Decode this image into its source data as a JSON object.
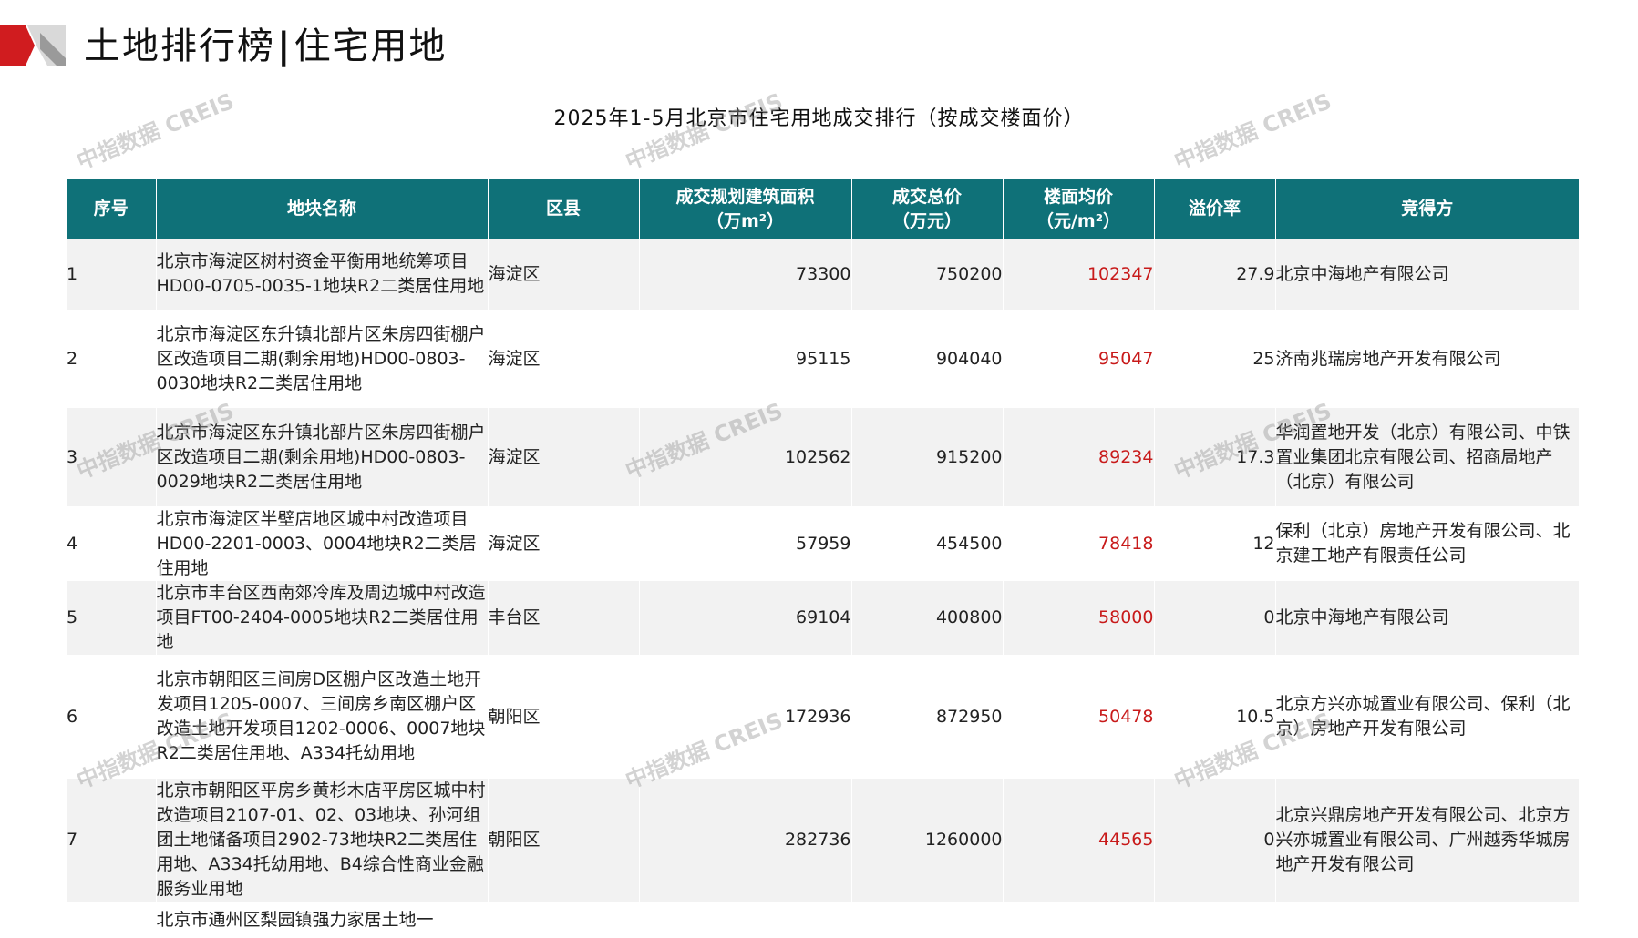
{
  "header": {
    "title_left": "土地排行榜",
    "separator": "|",
    "title_right": "住宅用地"
  },
  "watermark": {
    "text": "中指数据 CREIS"
  },
  "table_title": "2025年1-5月北京市住宅用地成交排行（按成交楼面价）",
  "columns": {
    "num": "序号",
    "name": "地块名称",
    "district": "区县",
    "area": "成交规划建筑面积\n（万m²）",
    "total": "成交总价\n（万元）",
    "price": "楼面均价\n（元/m²）",
    "premium": "溢价率",
    "bidder": "竞得方"
  },
  "rows": [
    {
      "num": "1",
      "name": "北京市海淀区树村资金平衡用地统筹项目HD00-0705-0035-1地块R2二类居住用地",
      "district": "海淀区",
      "area": "73300",
      "total": "750200",
      "price": "102347",
      "premium": "27.9",
      "bidder": "北京中海地产有限公司"
    },
    {
      "num": "2",
      "name": "北京市海淀区东升镇北部片区朱房四街棚户区改造项目二期(剩余用地)HD00-0803-0030地块R2二类居住用地",
      "district": "海淀区",
      "area": "95115",
      "total": "904040",
      "price": "95047",
      "premium": "25",
      "bidder": "济南兆瑞房地产开发有限公司"
    },
    {
      "num": "3",
      "name": "北京市海淀区东升镇北部片区朱房四街棚户区改造项目二期(剩余用地)HD00-0803-0029地块R2二类居住用地",
      "district": "海淀区",
      "area": "102562",
      "total": "915200",
      "price": "89234",
      "premium": "17.3",
      "bidder": "华润置地开发（北京）有限公司、中铁置业集团北京有限公司、招商局地产（北京）有限公司"
    },
    {
      "num": "4",
      "name": "北京市海淀区半壁店地区城中村改造项目HD00-2201-0003、0004地块R2二类居住用地",
      "district": "海淀区",
      "area": "57959",
      "total": "454500",
      "price": "78418",
      "premium": "12",
      "bidder": "保利（北京）房地产开发有限公司、北京建工地产有限责任公司"
    },
    {
      "num": "5",
      "name": "北京市丰台区西南郊冷库及周边城中村改造项目FT00-2404-0005地块R2二类居住用地",
      "district": "丰台区",
      "area": "69104",
      "total": "400800",
      "price": "58000",
      "premium": "0",
      "bidder": "北京中海地产有限公司"
    },
    {
      "num": "6",
      "name": "北京市朝阳区三间房D区棚户区改造土地开发项目1205-0007、三间房乡南区棚户区改造土地开发项目1202-0006、0007地块R2二类居住用地、A334托幼用地",
      "district": "朝阳区",
      "area": "172936",
      "total": "872950",
      "price": "50478",
      "premium": "10.5",
      "bidder": "北京方兴亦城置业有限公司、保利（北京）房地产开发有限公司"
    },
    {
      "num": "7",
      "name": "北京市朝阳区平房乡黄杉木店平房区城中村改造项目2107-01、02、03地块、孙河组团土地储备项目2902-73地块R2二类居住用地、A334托幼用地、B4综合性商业金融服务业用地",
      "district": "朝阳区",
      "area": "282736",
      "total": "1260000",
      "price": "44565",
      "premium": "0",
      "bidder": "北京兴鼎房地产开发有限公司、北京方兴亦城置业有限公司、广州越秀华城房地产开发有限公司"
    },
    {
      "num": "",
      "name": "北京市通州区梨园镇强力家居土地一",
      "district": "",
      "area": "",
      "total": "",
      "price": "",
      "premium": "",
      "bidder": ""
    }
  ]
}
